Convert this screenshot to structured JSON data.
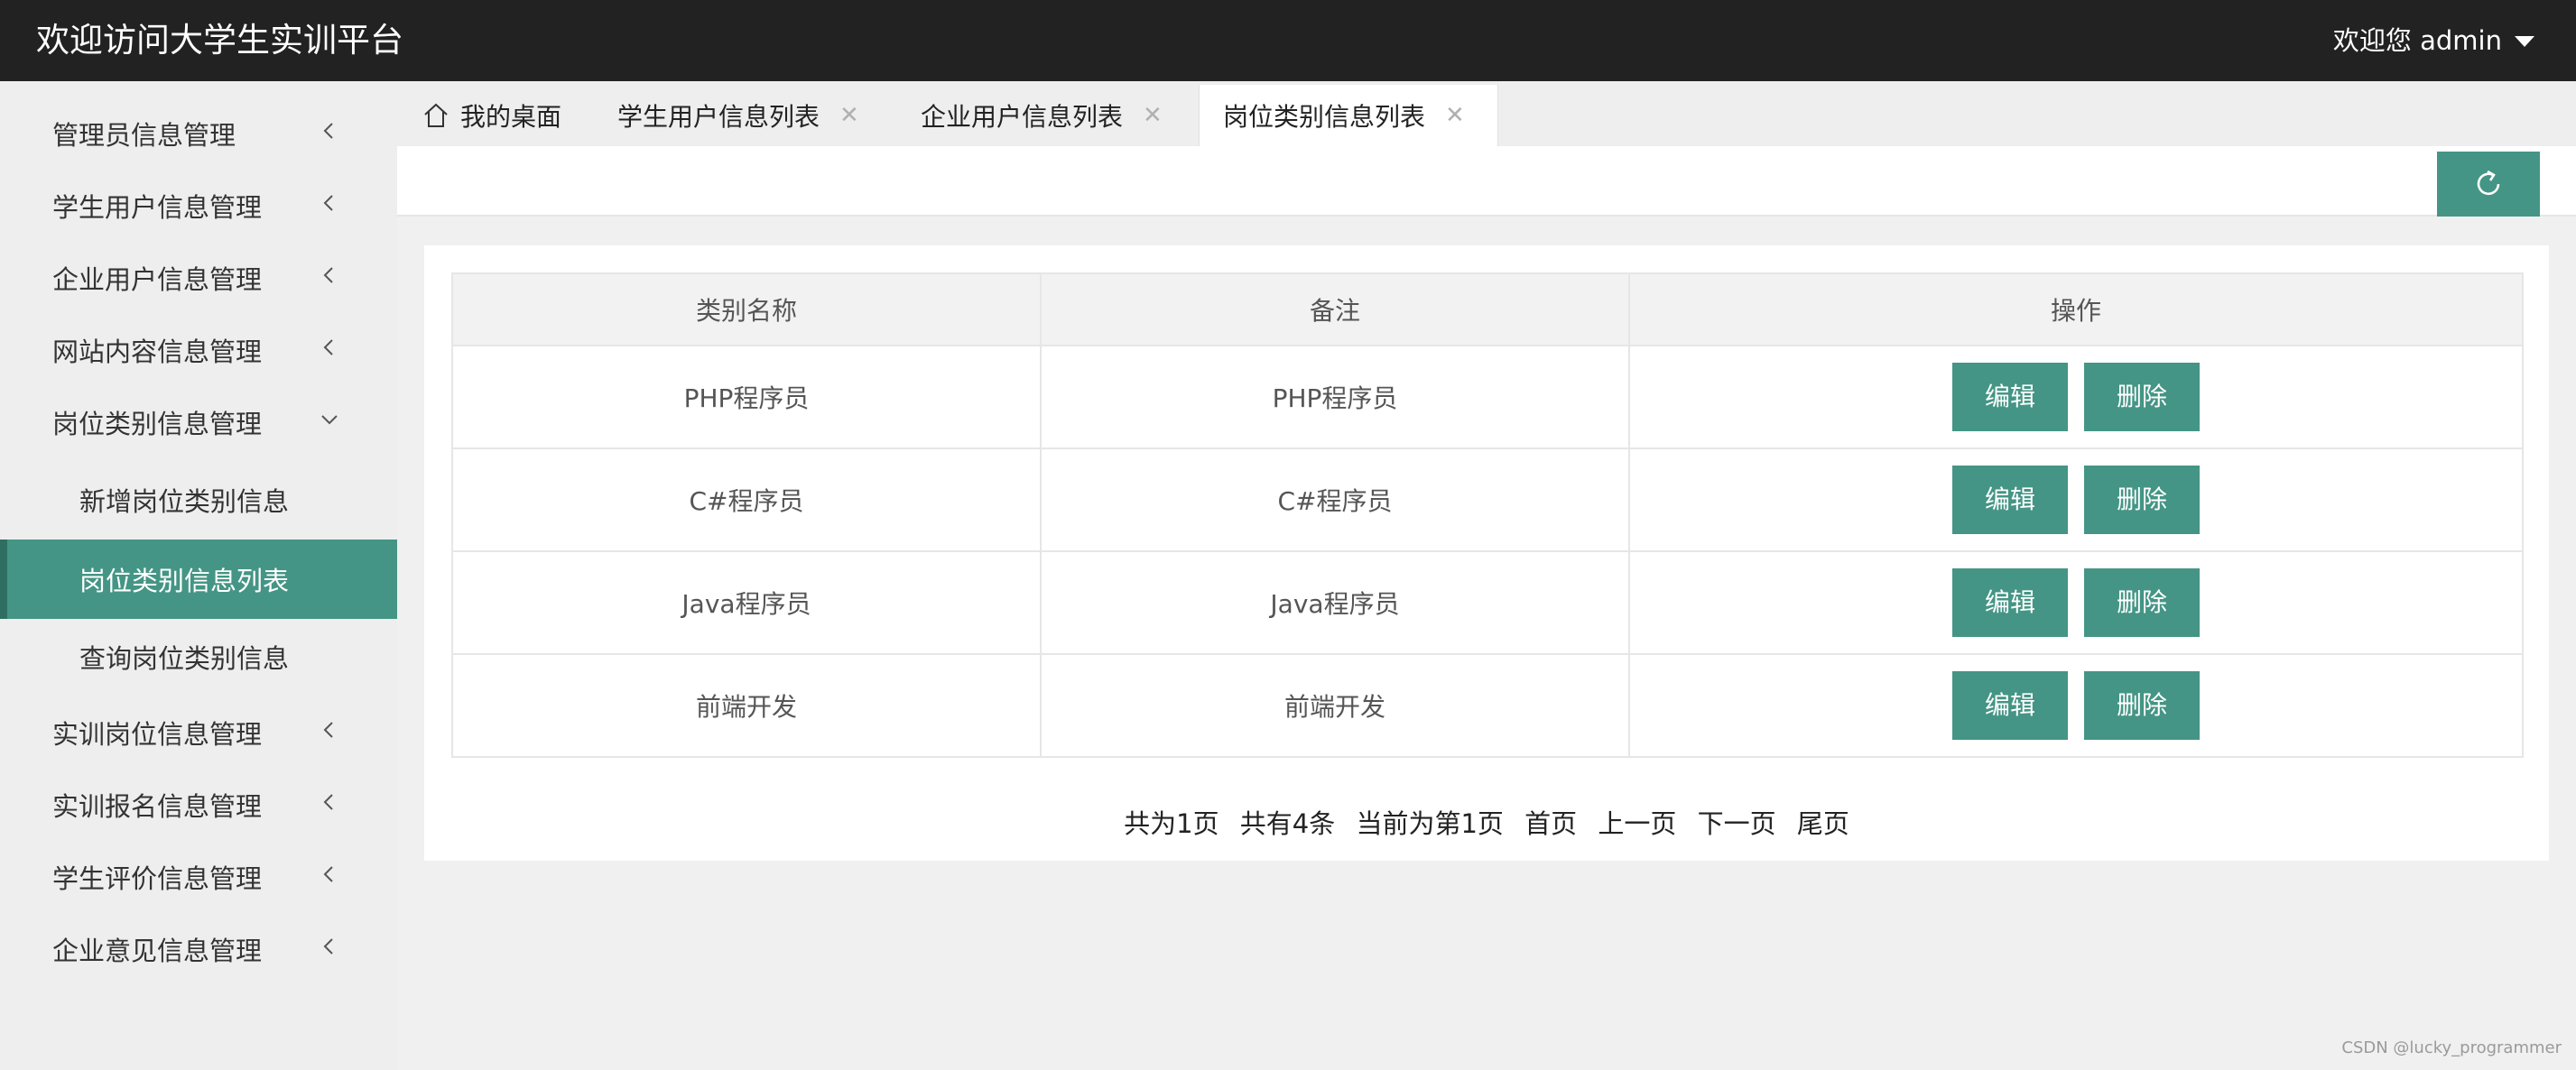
{
  "header": {
    "title": "欢迎访问大学生实训平台",
    "user_label": "欢迎您 admin"
  },
  "sidebar": {
    "items": [
      {
        "label": "管理员信息管理"
      },
      {
        "label": "学生用户信息管理"
      },
      {
        "label": "企业用户信息管理"
      },
      {
        "label": "网站内容信息管理"
      },
      {
        "label": "岗位类别信息管理",
        "expanded": true
      },
      {
        "label": "新增岗位类别信息"
      },
      {
        "label": "岗位类别信息列表",
        "active": true
      },
      {
        "label": "查询岗位类别信息"
      },
      {
        "label": "实训岗位信息管理"
      },
      {
        "label": "实训报名信息管理"
      },
      {
        "label": "学生评价信息管理"
      },
      {
        "label": "企业意见信息管理"
      }
    ]
  },
  "tabs": [
    {
      "label": "我的桌面"
    },
    {
      "label": "学生用户信息列表"
    },
    {
      "label": "企业用户信息列表"
    },
    {
      "label": "岗位类别信息列表",
      "active": true
    }
  ],
  "table": {
    "columns": [
      "类别名称",
      "备注",
      "操作"
    ],
    "rows": [
      {
        "name": "PHP程序员",
        "remark": "PHP程序员"
      },
      {
        "name": "C#程序员",
        "remark": "C#程序员"
      },
      {
        "name": "Java程序员",
        "remark": "Java程序员"
      },
      {
        "name": "前端开发",
        "remark": "前端开发"
      }
    ],
    "edit_label": "编辑",
    "delete_label": "删除"
  },
  "pager": {
    "total_pages": "共为1页",
    "total_items": "共有4条",
    "current": "当前为第1页",
    "first": "首页",
    "prev": "上一页",
    "next": "下一页",
    "last": "尾页"
  },
  "watermark": "CSDN @lucky_programmer",
  "colors": {
    "accent": "#449585",
    "header_bg": "#222222"
  }
}
